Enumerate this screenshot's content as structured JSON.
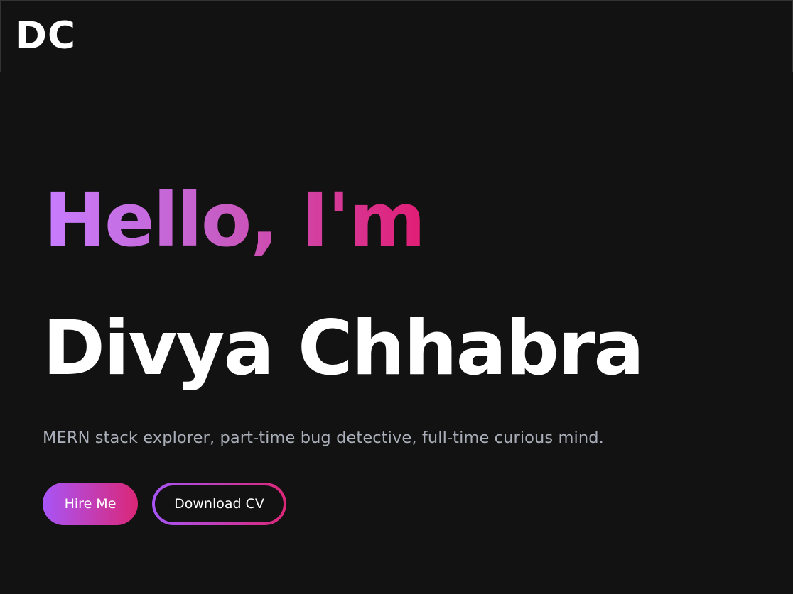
{
  "navbar": {
    "logo": "DC"
  },
  "hero": {
    "greeting": "Hello, I'm",
    "name": "Divya Chhabra",
    "tagline": "MERN stack explorer, part-time bug detective, full-time curious mind."
  },
  "actions": {
    "hire_label": "Hire Me",
    "cv_label": "Download CV"
  },
  "colors": {
    "background": "#121212",
    "gradient_start": "#a855f7",
    "gradient_end": "#db2777",
    "text_primary": "#ffffff",
    "text_muted": "#a9aeb8"
  }
}
